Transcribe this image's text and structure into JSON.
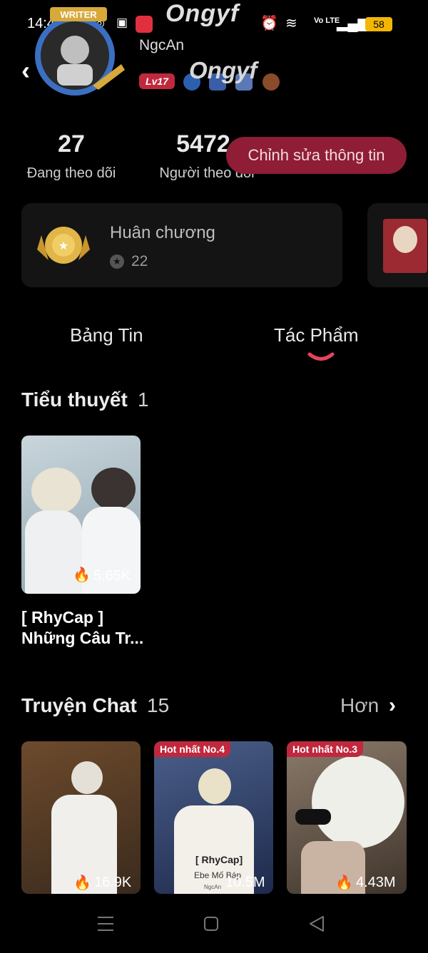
{
  "status_bar": {
    "time": "14:43",
    "battery": "58",
    "network": "Vo LTE"
  },
  "header": {
    "username": "NgcAn",
    "nickname": "Ongyf",
    "level": "Lv17",
    "avatar_frame_label": "WRITER"
  },
  "stats": {
    "following_count": "27",
    "following_label": "Đang theo dõi",
    "followers_count": "5472",
    "followers_label": "Người theo dõi",
    "edit_button": "Chỉnh sửa thông tin"
  },
  "medal": {
    "label": "Huân chương",
    "count": "22"
  },
  "tabs": [
    {
      "label": "Bảng Tin",
      "active": false
    },
    {
      "label": "Tác Phẩm",
      "active": true
    }
  ],
  "novels": {
    "title": "Tiểu thuyết",
    "count": "1",
    "items": [
      {
        "views": "5.65K",
        "title": "[ RhyCap ] Những Câu Tr..."
      }
    ]
  },
  "chat_stories": {
    "title": "Truyện Chat",
    "count": "15",
    "more_label": "Hơn",
    "items": [
      {
        "views": "16.9K",
        "tag": ""
      },
      {
        "views": "10.5M",
        "tag": "Hot nhất No.4",
        "overlay": "[ RhyCap]",
        "overlay2": "Ebe Mố Báp",
        "watermark": "NgcAn"
      },
      {
        "views": "4.43M",
        "tag": "Hot nhất No.3"
      }
    ]
  },
  "icons": [
    "back-icon",
    "fire-icon",
    "chevron-right-icon",
    "star-icon",
    "menu-nav-icon",
    "home-nav-icon",
    "back-nav-icon"
  ],
  "colors": {
    "accent": "#c0283e",
    "edit_button_bg": "#8e1d35",
    "underline": "#e8425f"
  }
}
